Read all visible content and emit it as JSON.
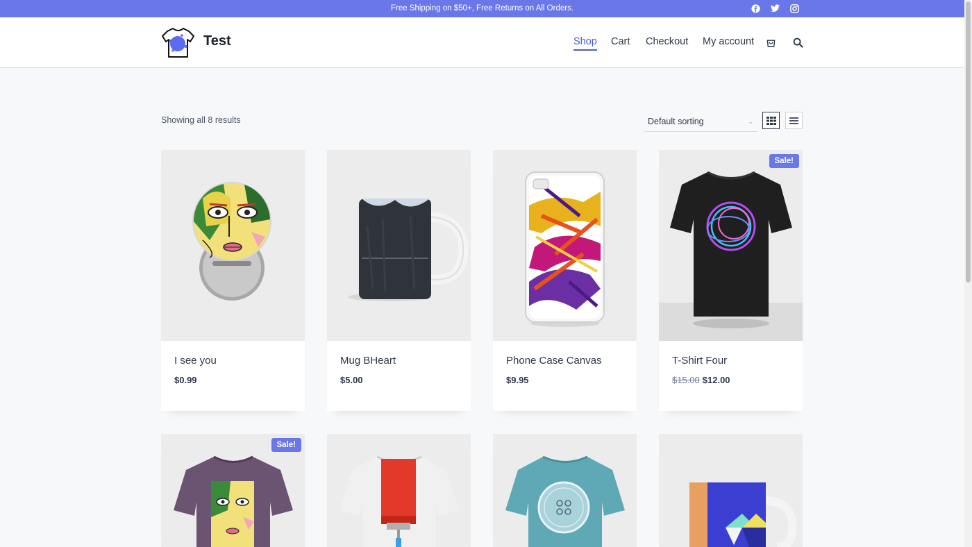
{
  "topbar": {
    "message": "Free Shipping on $50+, Free Returns on All Orders.",
    "social": [
      {
        "icon": "facebook-icon"
      },
      {
        "icon": "twitter-icon"
      },
      {
        "icon": "instagram-icon"
      }
    ]
  },
  "header": {
    "site_title": "Test",
    "nav": [
      "Shop",
      "Cart",
      "Checkout",
      "My account"
    ],
    "active_nav": "Shop",
    "icons": [
      "cart-icon",
      "search-icon"
    ]
  },
  "toolbar": {
    "results_text": "Showing all 8 results",
    "sort_selected": "Default sorting",
    "views": [
      "grid-view-icon",
      "list-view-icon"
    ],
    "active_view": "grid-view-icon"
  },
  "products": [
    {
      "name": "I see you",
      "price": "$0.99",
      "old_price": "",
      "sale": false,
      "badge": ""
    },
    {
      "name": "Mug BHeart",
      "price": "$5.00",
      "old_price": "",
      "sale": false,
      "badge": ""
    },
    {
      "name": "Phone Case Canvas",
      "price": "$9.95",
      "old_price": "",
      "sale": false,
      "badge": ""
    },
    {
      "name": "T-Shirt Four",
      "price": "$12.00",
      "old_price": "$15.00",
      "sale": true,
      "badge": "Sale!"
    },
    {
      "name": "",
      "price": "",
      "old_price": "",
      "sale": true,
      "badge": "Sale!"
    },
    {
      "name": "",
      "price": "",
      "old_price": "",
      "sale": false,
      "badge": ""
    },
    {
      "name": "",
      "price": "",
      "old_price": "",
      "sale": false,
      "badge": ""
    },
    {
      "name": "",
      "price": "",
      "old_price": "",
      "sale": false,
      "badge": ""
    }
  ],
  "colors": {
    "accent": "#6a77e8",
    "nav_active": "#4a5bd4",
    "text": "#2d3748",
    "page_bg": "#f7f8fa"
  }
}
